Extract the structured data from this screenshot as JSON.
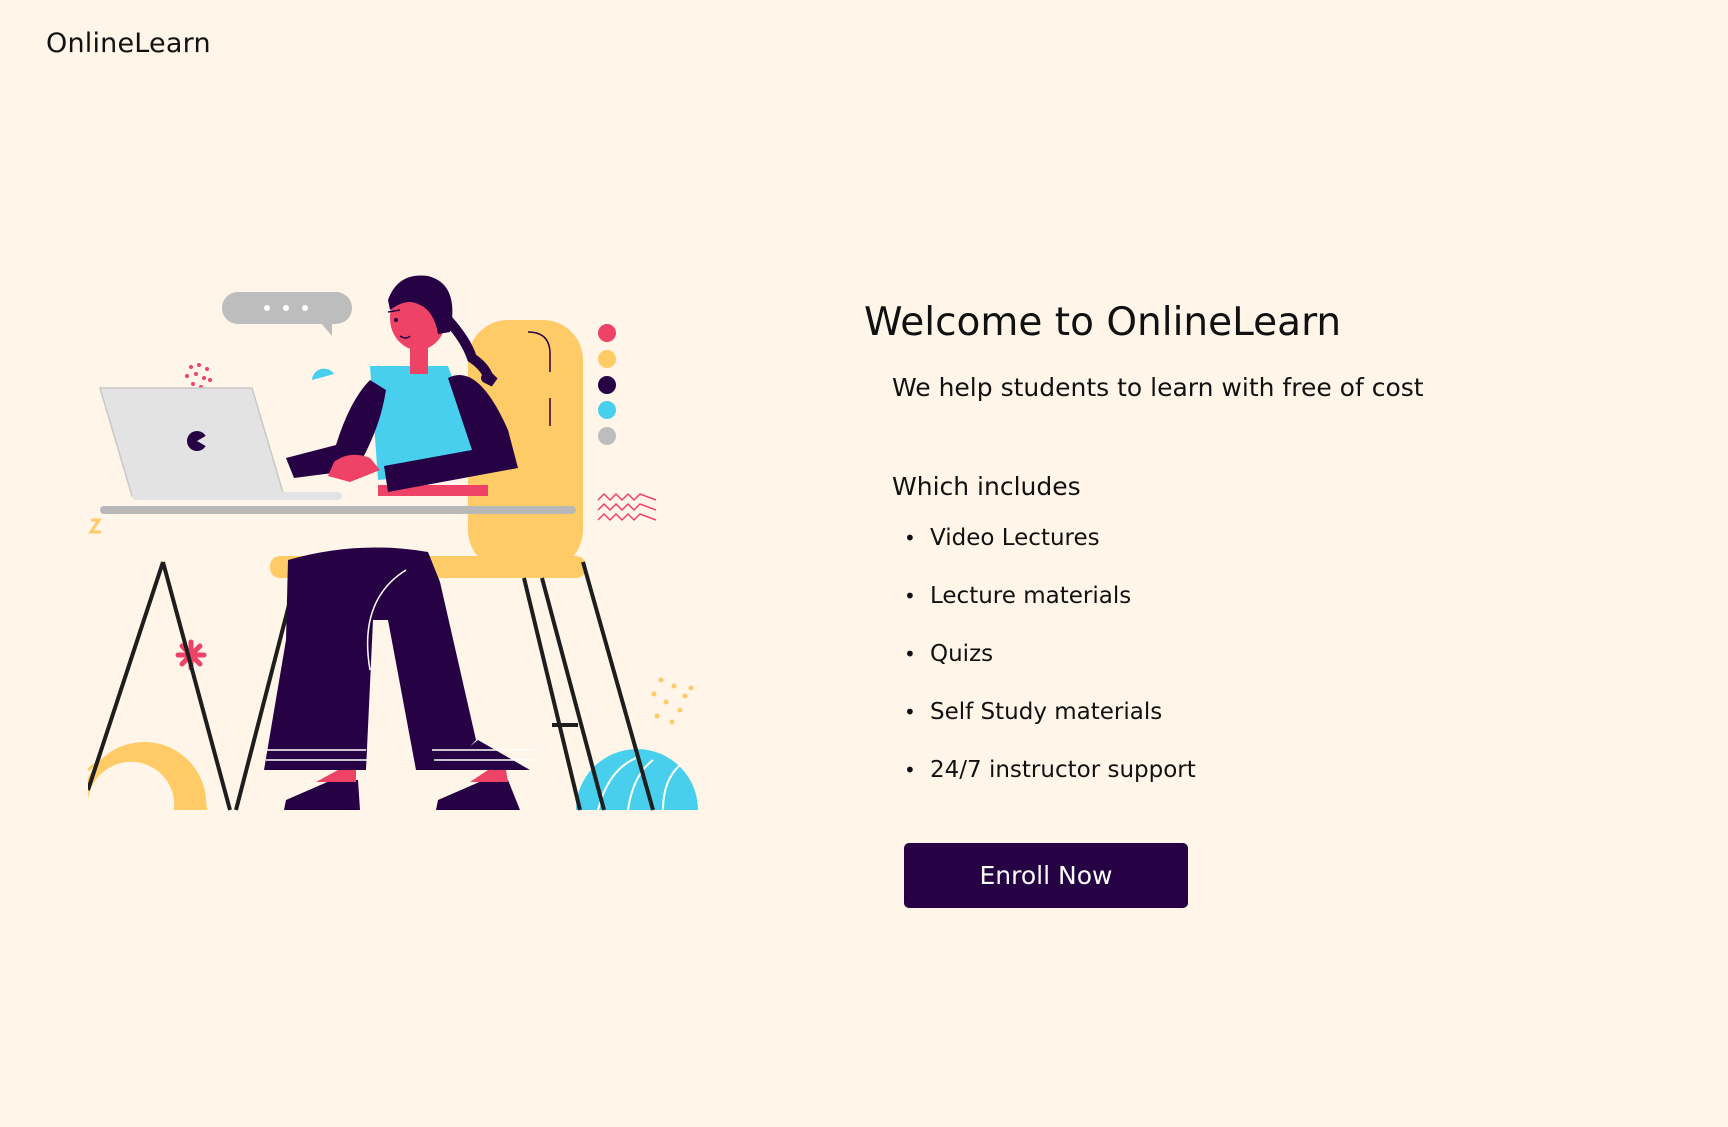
{
  "brand": {
    "name": "OnlineLearn"
  },
  "hero": {
    "title": "Welcome to OnlineLearn",
    "tagline": "We help students to learn with free of cost",
    "includes_heading": "Which includes",
    "features": [
      "Video Lectures",
      "Lecture materials",
      "Quizs",
      "Self Study materials",
      "24/7 instructor support"
    ],
    "cta_label": "Enroll Now"
  },
  "illustration": {
    "subject": "person-at-laptop-illustration",
    "colors": {
      "background": "#fff5e9",
      "dark": "#260244",
      "pink": "#ee4266",
      "yellow": "#ffcb66",
      "cyan": "#48cfed",
      "gray": "#bdbdbd"
    }
  },
  "colors": {
    "page_background": "#fff5e9",
    "text": "#111111",
    "button_background": "#260244",
    "button_text": "#ffffff"
  }
}
